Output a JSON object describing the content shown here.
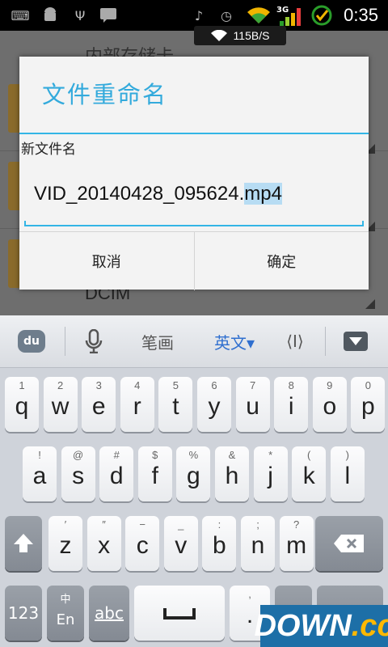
{
  "statusbar": {
    "time": "0:35",
    "network_label": "3G"
  },
  "net_toast": {
    "speed": "115B/S"
  },
  "background_list": {
    "header": "内部存储卡",
    "item": "DCIM"
  },
  "dialog": {
    "title": "文件重命名",
    "label": "新文件名",
    "filename_base": "VID_20140428_095624.",
    "filename_ext": "mp4",
    "cancel_label": "取消",
    "ok_label": "确定"
  },
  "keyboard": {
    "toolbar": {
      "logo": "du",
      "handwriting": "笔画",
      "language": "英文▾",
      "cursor": "⟨I⟩"
    },
    "row1": [
      {
        "k": "q",
        "n": "1"
      },
      {
        "k": "w",
        "n": "2"
      },
      {
        "k": "e",
        "n": "3"
      },
      {
        "k": "r",
        "n": "4"
      },
      {
        "k": "t",
        "n": "5"
      },
      {
        "k": "y",
        "n": "6"
      },
      {
        "k": "u",
        "n": "7"
      },
      {
        "k": "i",
        "n": "8"
      },
      {
        "k": "o",
        "n": "9"
      },
      {
        "k": "p",
        "n": "0"
      }
    ],
    "row2": [
      {
        "k": "a",
        "n": "!"
      },
      {
        "k": "s",
        "n": "@"
      },
      {
        "k": "d",
        "n": "#"
      },
      {
        "k": "f",
        "n": "$"
      },
      {
        "k": "g",
        "n": "%"
      },
      {
        "k": "h",
        "n": "&"
      },
      {
        "k": "j",
        "n": "*"
      },
      {
        "k": "k",
        "n": "("
      },
      {
        "k": "l",
        "n": ")"
      }
    ],
    "row3": [
      {
        "k": "z",
        "n": "′"
      },
      {
        "k": "x",
        "n": "″"
      },
      {
        "k": "c",
        "n": "−"
      },
      {
        "k": "v",
        "n": "_"
      },
      {
        "k": "b",
        "n": ":"
      },
      {
        "k": "n",
        "n": ";"
      },
      {
        "k": "m",
        "n": "?"
      }
    ],
    "bottom": {
      "num": "123",
      "lang_top": "中",
      "lang_bottom": "En",
      "abc": "abc",
      "period": ".",
      "period_top": ",",
      "at": "@"
    }
  },
  "watermark": {
    "main": "DOWN",
    "suffix": ".cc"
  }
}
